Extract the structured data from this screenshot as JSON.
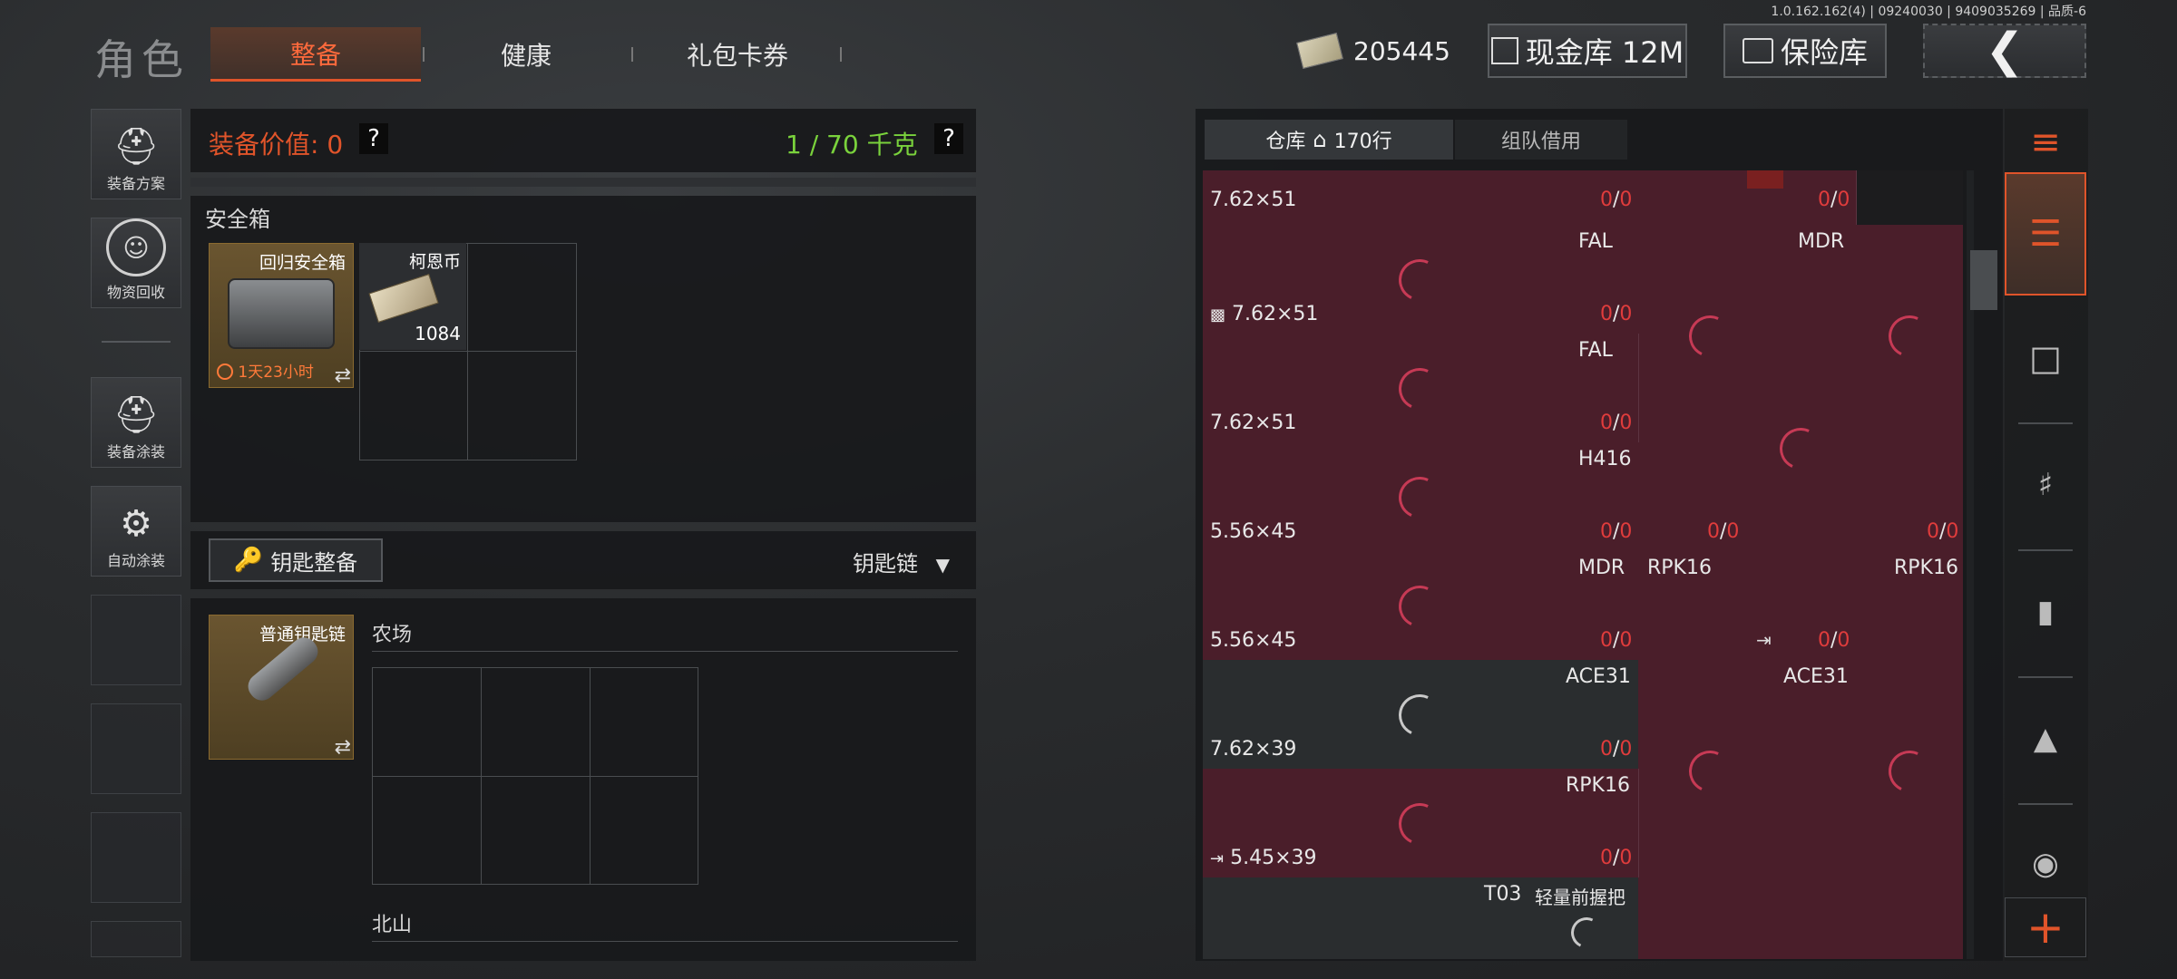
{
  "version": "1.0.162.162(4) | 09240030 | 9409035269 | 品质-6",
  "header": {
    "title": "角色",
    "tabs": [
      {
        "label": "整备",
        "active": true
      },
      {
        "label": "健康",
        "active": false
      },
      {
        "label": "礼包卡券",
        "active": false
      }
    ],
    "money": "205445",
    "cash_vault": "现金库 12M",
    "insurance": "保险库"
  },
  "left_rail": [
    {
      "label": "装备方案",
      "icon": "helmet-icon"
    },
    {
      "label": "物资回收",
      "icon": "recycle-icon"
    },
    {
      "label": "装备涂装",
      "icon": "paint-helmet-icon"
    },
    {
      "label": "自动涂装",
      "icon": "auto-paint-icon"
    }
  ],
  "equipment": {
    "value_label": "装备价值: 0",
    "weight": "1 / 70 千克",
    "help": "?"
  },
  "safe_box": {
    "title": "安全箱",
    "item_name": "回归安全箱",
    "timer": "1天23小时",
    "coin_name": "柯恩币",
    "coin_count": "1084"
  },
  "key_section": {
    "button": "钥匙整备",
    "dropdown": "钥匙链",
    "keychain_name": "普通钥匙链",
    "farm": "农场",
    "north": "北山"
  },
  "inventory": {
    "tab_storage": "仓库",
    "rows": "170行",
    "tab_team": "组队借用",
    "cards": [
      {
        "name": "",
        "caliber": "7.62×51",
        "ammo": "0",
        "max": "0"
      },
      {
        "name": "FAL",
        "caliber": "7.62×51",
        "ammo": "0",
        "max": "0"
      },
      {
        "name": "FAL",
        "caliber": "7.62×51",
        "ammo": "0",
        "max": "0"
      },
      {
        "name": "H416",
        "caliber": "5.56×45",
        "ammo": "0",
        "max": "0"
      },
      {
        "name": "MDR",
        "caliber": "5.56×45",
        "ammo": "0",
        "max": "0"
      },
      {
        "name": "ACE31",
        "caliber": "7.62×39",
        "ammo": "0",
        "max": "0"
      },
      {
        "name": "RPK16",
        "caliber": "5.45×39",
        "ammo": "0",
        "max": "0"
      },
      {
        "name": "T03",
        "caliber": "",
        "ammo": "",
        "max": ""
      }
    ],
    "right_cards": [
      {
        "name": "",
        "ammo": "0",
        "max": "0"
      },
      {
        "name": "MDR",
        "ammo": "",
        "max": ""
      },
      {
        "name": "RPK16",
        "ammo": "0",
        "max": "0"
      },
      {
        "name": "RPK16",
        "ammo": "0",
        "max": "0"
      },
      {
        "name": "ACE31",
        "ammo": "",
        "max": ""
      }
    ],
    "grip": "轻量前握把",
    "small_ammo_a": "0",
    "small_max_a": "0",
    "small_ammo_b": "0",
    "small_max_b": "0",
    "small_ammo_c": "0",
    "small_max_c": "0"
  },
  "colors": {
    "accent": "#e0542a",
    "weight_green": "#7ad23c",
    "ammo_red": "#e03c3c",
    "plus": "#e0542a"
  }
}
